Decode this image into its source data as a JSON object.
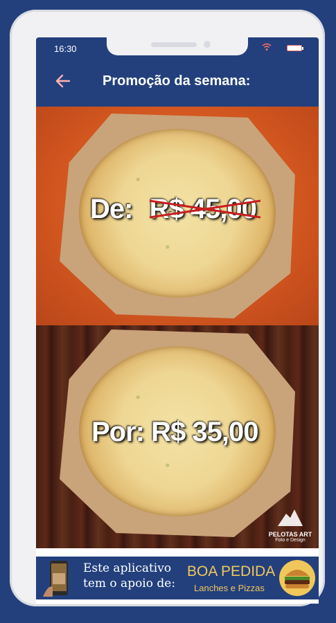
{
  "status_bar": {
    "time": "16:30"
  },
  "app_bar": {
    "title": "Promoção da semana:",
    "back_icon": "arrow-left-icon"
  },
  "promo": {
    "from_label": "De:",
    "old_price": "R$ 45,00",
    "to_label": "Por:",
    "new_price": "R$ 35,00",
    "watermark": {
      "name": "PELOTAS ART",
      "sub": "Foto e Design"
    }
  },
  "banner": {
    "support_line1": "Este aplicativo",
    "support_line2": "tem o apoio de:",
    "brand": "BOA PEDIDA",
    "brand_sub": "Lanches e Pizzas"
  },
  "colors": {
    "primary": "#23407d",
    "top_background": "#d2561f",
    "brand_gold": "#f0c75a",
    "strike_red": "#c81e1e"
  }
}
